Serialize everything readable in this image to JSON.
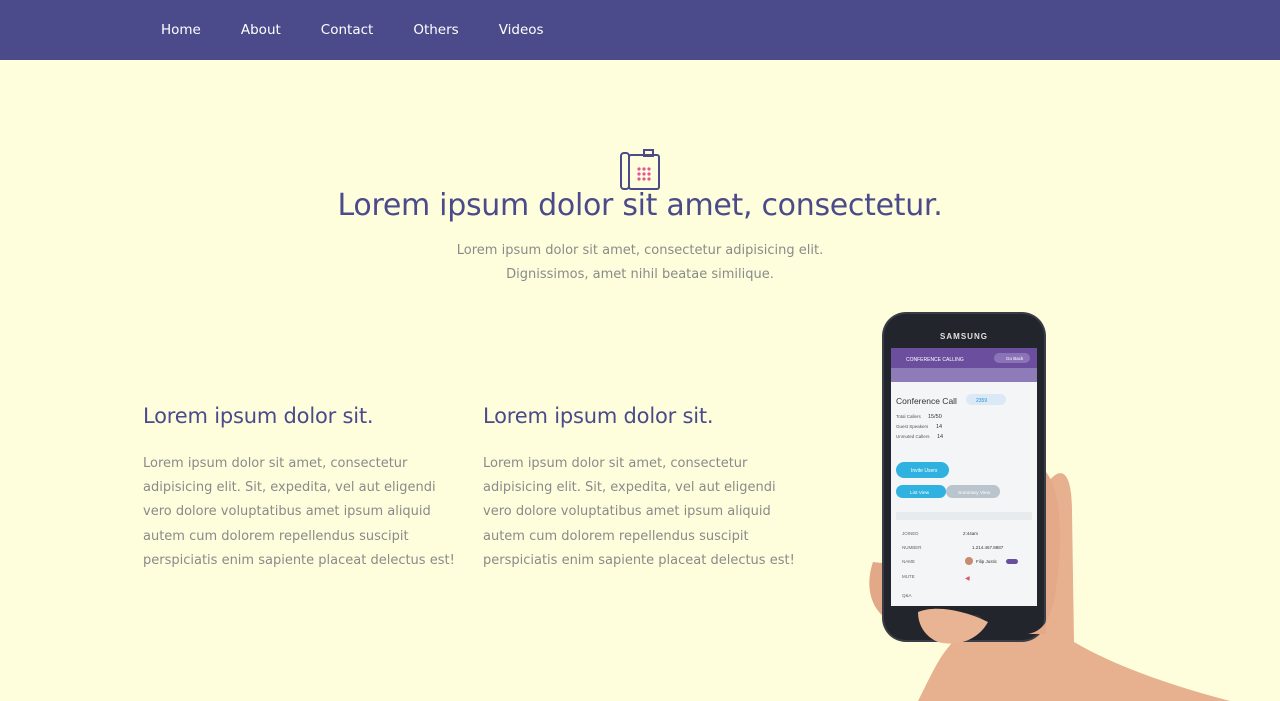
{
  "nav": {
    "items": [
      {
        "label": "Home"
      },
      {
        "label": "About"
      },
      {
        "label": "Contact"
      },
      {
        "label": "Others"
      },
      {
        "label": "Videos"
      }
    ]
  },
  "hero": {
    "icon": "phone-dialpad-icon",
    "title": "Lorem ipsum dolor sit amet, consectetur.",
    "subtitle_line1": "Lorem ipsum dolor sit amet, consectetur adipisicing elit.",
    "subtitle_line2": "Dignissimos, amet nihil beatae similique."
  },
  "features": [
    {
      "title": "Lorem ipsum dolor sit.",
      "text": "Lorem ipsum dolor sit amet, consectetur adipisicing elit. Sit, expedita, vel aut eligendi vero dolore voluptatibus amet ipsum aliquid autem cum dolorem repellendus suscipit perspiciatis enim sapiente placeat delectus est!"
    },
    {
      "title": "Lorem ipsum dolor sit.",
      "text": "Lorem ipsum dolor sit amet, consectetur adipisicing elit. Sit, expedita, vel aut eligendi vero dolore voluptatibus amet ipsum aliquid autem cum dolorem repellendus suscipit perspiciatis enim sapiente placeat delectus est!"
    }
  ],
  "phone": {
    "brand": "SAMSUNG",
    "app_header": "CONFERENCE CALLING",
    "go_back": "Go Back",
    "screen_title": "Conference Call",
    "badge": "2359",
    "stats": [
      {
        "label": "Total Callers",
        "value": "15/50"
      },
      {
        "label": "Guest Speakers",
        "value": "14"
      },
      {
        "label": "Unmuted Callers",
        "value": "14"
      }
    ],
    "invite_button": "Invite Users",
    "list_view": "List View",
    "summary_view": "Summary View",
    "rows": [
      {
        "label": "JOINED",
        "value": "2:44am"
      },
      {
        "label": "NUMBER",
        "value": "1.214.467.8887"
      },
      {
        "label": "NAME",
        "value": "Filip Justic"
      },
      {
        "label": "MUTE",
        "value": ""
      },
      {
        "label": "Q&A",
        "value": ""
      }
    ]
  },
  "colors": {
    "nav_bg": "#4b4b8b",
    "page_bg": "#fffedc",
    "accent": "#4b4b8b",
    "icon_dots": "#e8509a"
  }
}
